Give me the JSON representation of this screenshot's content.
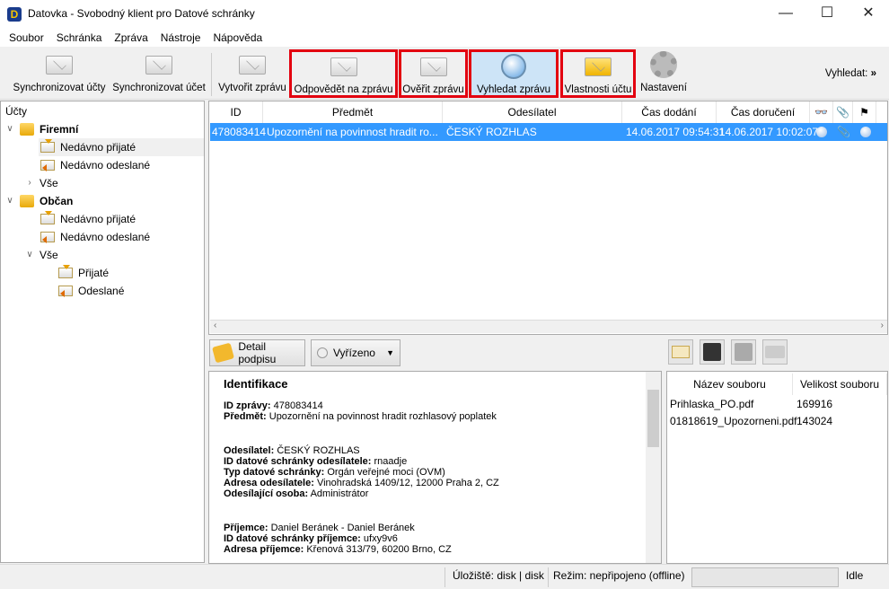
{
  "window": {
    "title": "Datovka - Svobodný klient pro Datové schránky",
    "minimize": "—",
    "maximize": "☐",
    "close": "✕"
  },
  "menu": [
    "Soubor",
    "Schránka",
    "Zpráva",
    "Nástroje",
    "Nápověda"
  ],
  "toolbar": {
    "items": [
      "Synchronizovat účty",
      "Synchronizovat účet",
      "Vytvořit zprávu",
      "Odpovědět na zprávu",
      "Ověřit zprávu",
      "Vyhledat zprávu",
      "Vlastnosti účtu",
      "Nastavení"
    ],
    "search_label": "Vyhledat:",
    "overflow": "»"
  },
  "tree": {
    "root": "Účty",
    "accounts": [
      {
        "name": "Firemní",
        "recent_received": "Nedávno přijaté",
        "recent_sent": "Nedávno odeslané",
        "all": "Vše"
      },
      {
        "name": "Občan",
        "recent_received": "Nedávno přijaté",
        "recent_sent": "Nedávno odeslané",
        "all": "Vše",
        "received": "Přijaté",
        "sent": "Odeslané"
      }
    ]
  },
  "messages": {
    "columns": [
      "ID",
      "Předmět",
      "Odesílatel",
      "Čas dodání",
      "Čas doručení"
    ],
    "rows": [
      {
        "id": "478083414",
        "subject": "Upozornění na povinnost hradit ro...",
        "sender": "ČESKÝ ROZHLAS",
        "delivered": "14.06.2017 09:54:31",
        "accepted": "14.06.2017 10:02:07"
      }
    ]
  },
  "actions": {
    "signature_detail": "Detail podpisu",
    "status_select": "Vyřízeno"
  },
  "detail": {
    "title": "Identifikace",
    "groups": [
      [
        {
          "label": "ID zprávy:",
          "value": "478083414"
        },
        {
          "label": "Předmět:",
          "value": "Upozornění na povinnost hradit rozhlasový poplatek"
        }
      ],
      [
        {
          "label": "Odesílatel:",
          "value": "ČESKÝ ROZHLAS"
        },
        {
          "label": "ID datové schránky odesílatele:",
          "value": "rnaadje"
        },
        {
          "label": "Typ datové schránky:",
          "value": "Orgán veřejné moci (OVM)"
        },
        {
          "label": "Adresa odesílatele:",
          "value": "Vinohradská 1409/12, 12000 Praha 2, CZ"
        },
        {
          "label": "Odesílající osoba:",
          "value": "Administrátor"
        }
      ],
      [
        {
          "label": "Příjemce:",
          "value": "Daniel Beránek - Daniel Beránek"
        },
        {
          "label": "ID datové schránky příjemce:",
          "value": "ufxy9v6"
        },
        {
          "label": "Adresa příjemce:",
          "value": "Křenová 313/79, 60200 Brno, CZ"
        }
      ]
    ]
  },
  "attachments": {
    "columns": [
      "Název souboru",
      "Velikost souboru"
    ],
    "rows": [
      {
        "name": "Prihlaska_PO.pdf",
        "size": "169916"
      },
      {
        "name": "01818619_Upozorneni.pdf",
        "size": "143024"
      }
    ]
  },
  "status": {
    "storage": "Úložiště: disk | disk",
    "mode": "Režim: nepřipojeno (offline)",
    "state": "Idle"
  },
  "colors": {
    "selection": "#3399ff",
    "highlight": "#e3000f"
  }
}
